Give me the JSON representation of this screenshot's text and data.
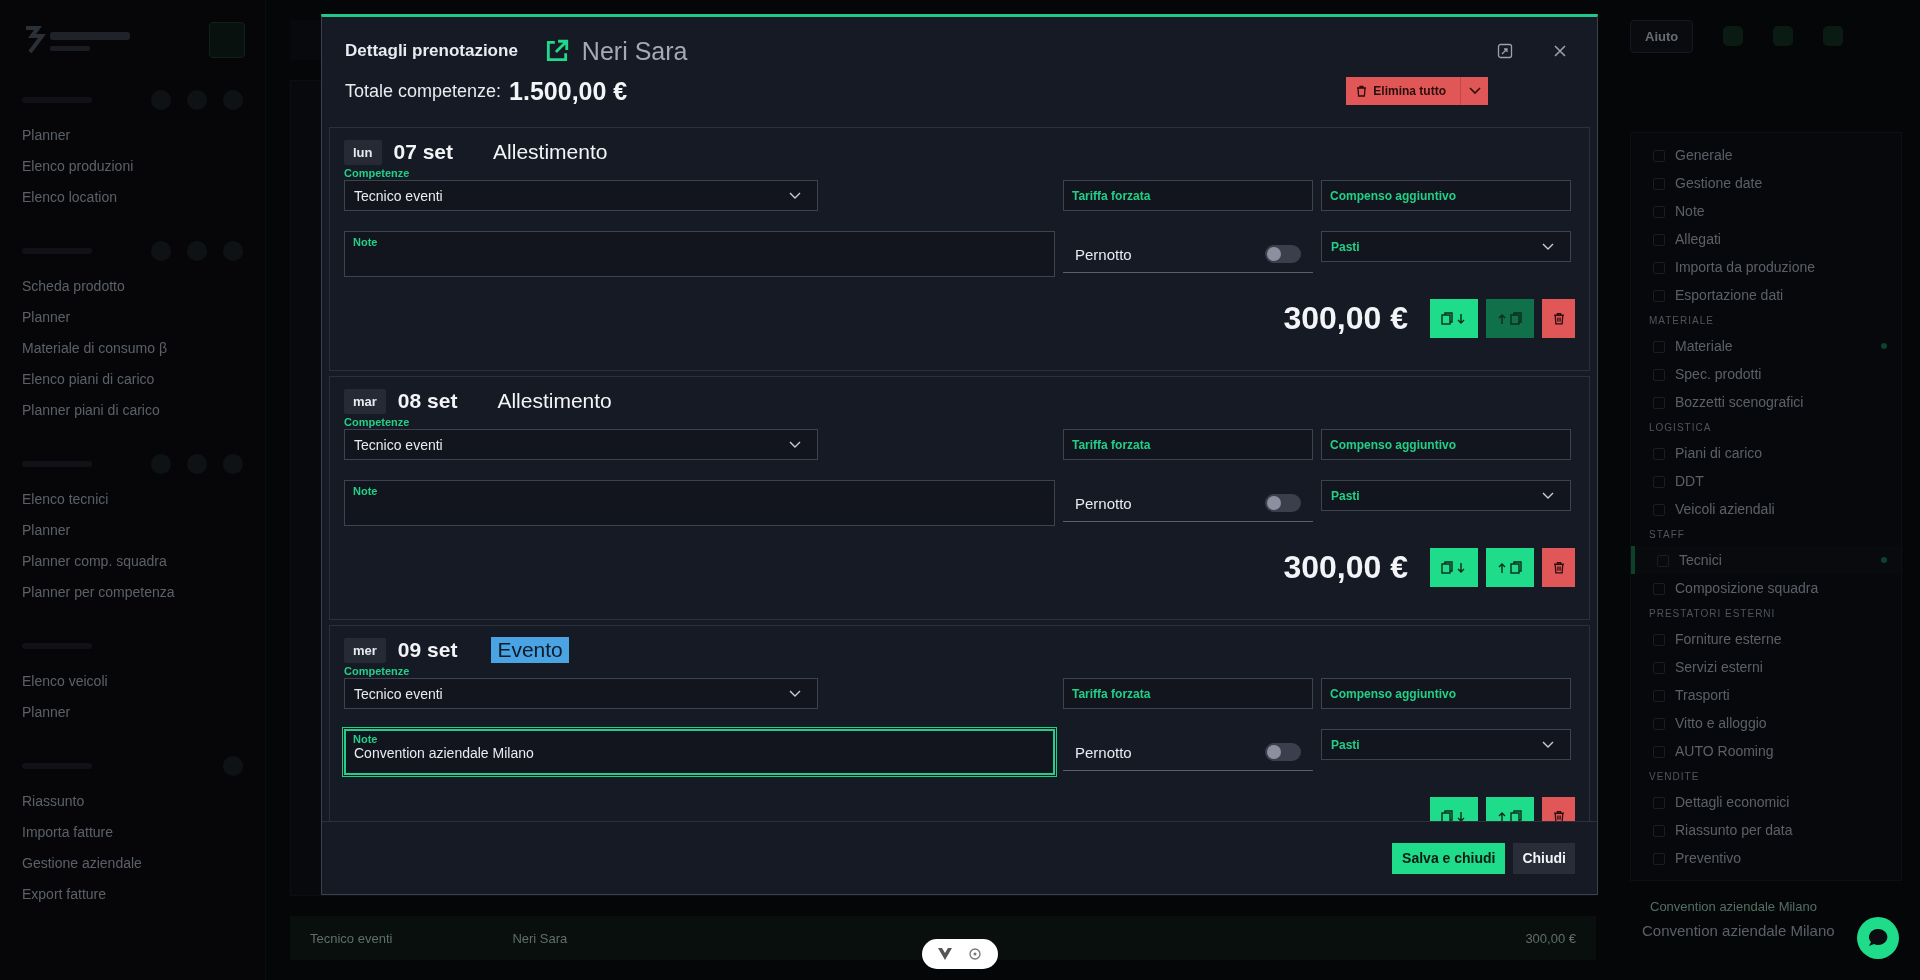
{
  "sidebar": {
    "sections": [
      {
        "kind": "tools",
        "items": [
          "Planner",
          "Elenco produzioni",
          "Elenco location"
        ]
      },
      {
        "kind": "tools",
        "items": [
          "Scheda prodotto",
          "Planner",
          "Materiale di consumo β",
          "Elenco piani di carico",
          "Planner piani di carico"
        ]
      },
      {
        "kind": "tools",
        "items": [
          "Elenco tecnici",
          "Planner",
          "Planner comp. squadra",
          "Planner per competenza"
        ]
      },
      {
        "kind": "plain",
        "items": [
          "Elenco veicoli",
          "Planner"
        ]
      },
      {
        "kind": "settings",
        "items": [
          "Riassunto",
          "Importa fatture",
          "Gestione aziendale",
          "Export fatture"
        ]
      }
    ]
  },
  "topbar": {
    "help_button": "Aiuto"
  },
  "background_row": {
    "role": "Tecnico eventi",
    "person": "Neri Sara",
    "amount": "300,00 €"
  },
  "project_panel": {
    "sections": [
      {
        "items": [
          {
            "label": "Generale",
            "indicator": false,
            "selected": false
          },
          {
            "label": "Gestione date",
            "indicator": false,
            "selected": false
          },
          {
            "label": "Note",
            "indicator": false,
            "selected": false
          },
          {
            "label": "Allegati",
            "indicator": false,
            "selected": false
          },
          {
            "label": "Importa da produzione",
            "indicator": false,
            "selected": false
          },
          {
            "label": "Esportazione dati",
            "indicator": false,
            "selected": false
          }
        ]
      },
      {
        "header": "MATERIALE",
        "items": [
          {
            "label": "Materiale",
            "indicator": true,
            "selected": false
          },
          {
            "label": "Spec. prodotti",
            "indicator": false,
            "selected": false
          },
          {
            "label": "Bozzetti scenografici",
            "indicator": false,
            "selected": false
          }
        ]
      },
      {
        "header": "LOGISTICA",
        "items": [
          {
            "label": "Piani di carico",
            "indicator": false,
            "selected": false
          },
          {
            "label": "DDT",
            "indicator": false,
            "selected": false
          },
          {
            "label": "Veicoli aziendali",
            "indicator": false,
            "selected": false
          }
        ]
      },
      {
        "header": "STAFF",
        "items": [
          {
            "label": "Tecnici",
            "indicator": true,
            "selected": true
          },
          {
            "label": "Composizione squadra",
            "indicator": false,
            "selected": false
          }
        ]
      },
      {
        "header": "PRESTATORI ESTERNI",
        "items": [
          {
            "label": "Forniture esterne",
            "indicator": false,
            "selected": false
          },
          {
            "label": "Servizi esterni",
            "indicator": false,
            "selected": false
          },
          {
            "label": "Trasporti",
            "indicator": false,
            "selected": false
          },
          {
            "label": "Vitto e alloggio",
            "indicator": false,
            "selected": false
          },
          {
            "label": "AUTO Rooming",
            "indicator": false,
            "selected": false
          }
        ]
      },
      {
        "header": "VENDITE",
        "items": [
          {
            "label": "Dettagli economici",
            "indicator": false,
            "selected": false
          },
          {
            "label": "Riassunto per data",
            "indicator": false,
            "selected": false
          },
          {
            "label": "Preventivo",
            "indicator": false,
            "selected": false
          }
        ]
      }
    ],
    "note_label": "Convention aziendale Milano",
    "note_value": "Convention aziendale Milano"
  },
  "modal": {
    "title": "Dettagli prenotazione",
    "person": "Neri Sara",
    "total_label": "Totale competenze:",
    "total": "1.500,00 €",
    "delete_all": "Elimina tutto",
    "cards": [
      {
        "weekday": "lun",
        "date": "07 set",
        "phase": "Allestimento",
        "phase_highlighted": false,
        "competence_label": "Competenze",
        "competence": "Tecnico eventi",
        "tariff_placeholder": "Tariffa forzata",
        "extra_placeholder": "Compenso aggiuntivo",
        "note_label": "Note",
        "note_focused": false,
        "overnight_label": "Pernotto",
        "overnight": false,
        "meals_label": "Pasti",
        "amount": "300,00 €",
        "copy_up_disabled": true
      },
      {
        "weekday": "mar",
        "date": "08 set",
        "phase": "Allestimento",
        "phase_highlighted": false,
        "competence_label": "Competenze",
        "competence": "Tecnico eventi",
        "tariff_placeholder": "Tariffa forzata",
        "extra_placeholder": "Compenso aggiuntivo",
        "note_label": "Note",
        "note_focused": false,
        "overnight_label": "Pernotto",
        "overnight": false,
        "meals_label": "Pasti",
        "amount": "300,00 €",
        "copy_up_disabled": false
      },
      {
        "weekday": "mer",
        "date": "09 set",
        "phase": "Evento",
        "phase_highlighted": true,
        "competence_label": "Competenze",
        "competence": "Tecnico eventi",
        "tariff_placeholder": "Tariffa forzata",
        "extra_placeholder": "Compenso aggiuntivo",
        "note_label": "Note",
        "note": "Convention aziendale Milano",
        "note_focused": true,
        "overnight_label": "Pernotto",
        "overnight": false,
        "meals_label": "Pasti",
        "copy_up_disabled": false
      }
    ],
    "save_button": "Salva e chiudi",
    "close_button": "Chiudi"
  }
}
